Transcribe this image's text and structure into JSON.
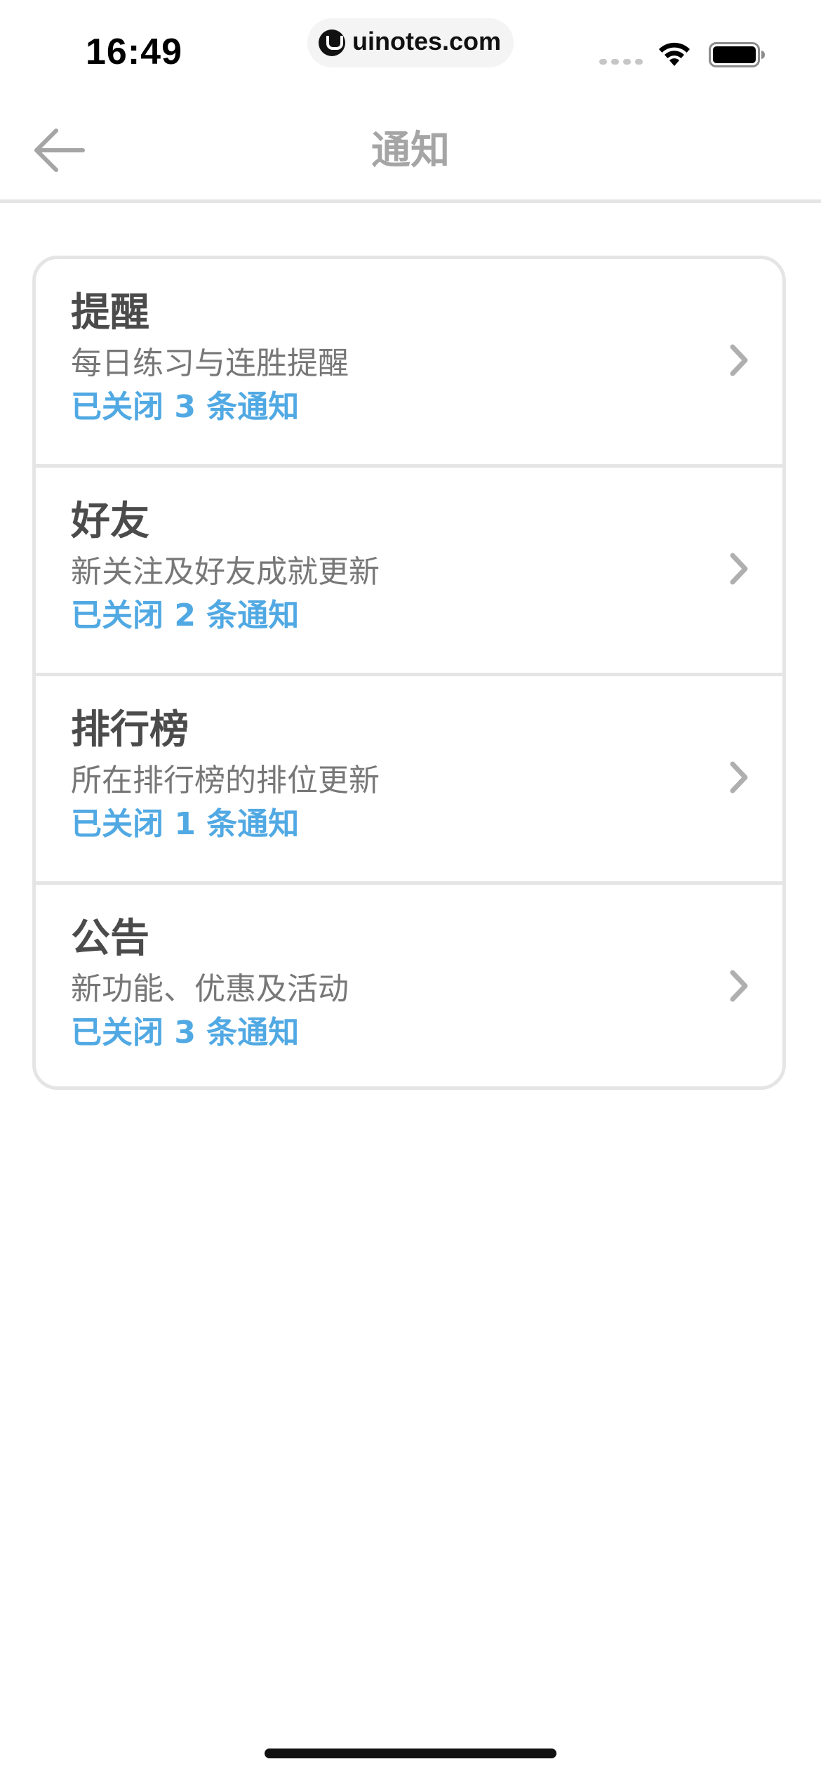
{
  "status_bar": {
    "time": "16:49",
    "url": "uinotes.com"
  },
  "header": {
    "title": "通知"
  },
  "notifications": [
    {
      "title": "提醒",
      "description": "每日练习与连胜提醒",
      "status": "已关闭 3 条通知"
    },
    {
      "title": "好友",
      "description": "新关注及好友成就更新",
      "status": "已关闭 2 条通知"
    },
    {
      "title": "排行榜",
      "description": "所在排行榜的排位更新",
      "status": "已关闭 1 条通知"
    },
    {
      "title": "公告",
      "description": "新功能、优惠及活动",
      "status": "已关闭 3 条通知"
    }
  ],
  "colors": {
    "status_text": "#51a9e3",
    "title_text": "#4b4b4b",
    "description_text": "#777777",
    "header_title": "#a5a5a5",
    "border": "#e5e5e5"
  },
  "icons": {
    "back": "arrow-left-icon",
    "chevron": "chevron-right-icon",
    "wifi": "wifi-icon",
    "battery": "battery-icon",
    "signal": "signal-icon"
  }
}
